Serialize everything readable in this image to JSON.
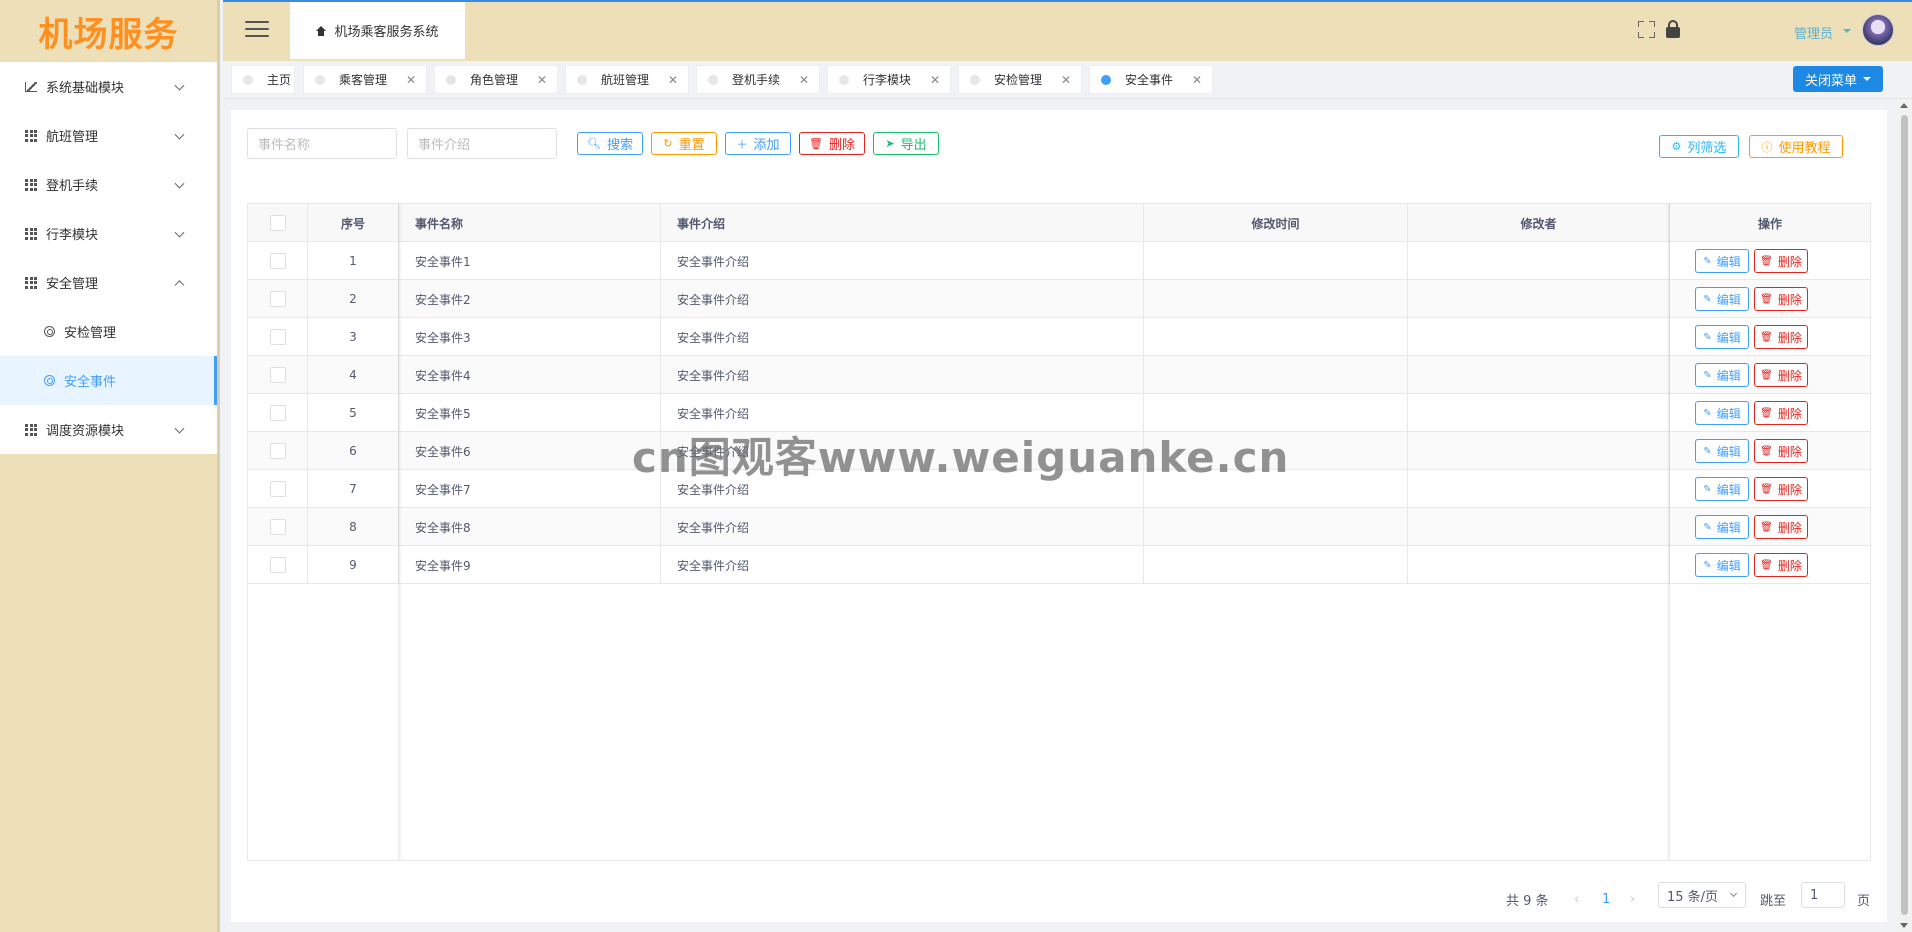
{
  "logo": "机场服务",
  "sidebar": {
    "items": [
      {
        "label": "系统基础模块",
        "icon": "chart-icon"
      },
      {
        "label": "航班管理",
        "icon": "grid-icon"
      },
      {
        "label": "登机手续",
        "icon": "grid-icon"
      },
      {
        "label": "行李模块",
        "icon": "grid-icon"
      },
      {
        "label": "安全管理",
        "icon": "grid-icon",
        "expanded": true
      },
      {
        "label": "安检管理",
        "icon": "circle-icon",
        "sub": true
      },
      {
        "label": "安全事件",
        "icon": "circle-icon",
        "sub": true,
        "active": true
      },
      {
        "label": "调度资源模块",
        "icon": "grid-icon"
      }
    ]
  },
  "header": {
    "home_tab": "机场乘客服务系统",
    "user": "管理员"
  },
  "tabs": [
    {
      "label": "主页",
      "closable": false
    },
    {
      "label": "乘客管理",
      "closable": true
    },
    {
      "label": "角色管理",
      "closable": true
    },
    {
      "label": "航班管理",
      "closable": true
    },
    {
      "label": "登机手续",
      "closable": true
    },
    {
      "label": "行李模块",
      "closable": true
    },
    {
      "label": "安检管理",
      "closable": true
    },
    {
      "label": "安全事件",
      "closable": true,
      "active": true
    }
  ],
  "close_menu": "关闭菜单",
  "search": {
    "name_placeholder": "事件名称",
    "intro_placeholder": "事件介绍"
  },
  "toolbar": {
    "search": "搜索",
    "reset": "重置",
    "add": "添加",
    "delete": "删除",
    "export": "导出",
    "column_filter": "列筛选",
    "tutorial": "使用教程"
  },
  "table": {
    "headers": [
      "序号",
      "事件名称",
      "事件介绍",
      "修改时间",
      "修改者",
      "操作"
    ],
    "rows": [
      {
        "no": "1",
        "name": "安全事件1",
        "intro": "安全事件介绍",
        "time": "",
        "editor": ""
      },
      {
        "no": "2",
        "name": "安全事件2",
        "intro": "安全事件介绍",
        "time": "",
        "editor": ""
      },
      {
        "no": "3",
        "name": "安全事件3",
        "intro": "安全事件介绍",
        "time": "",
        "editor": ""
      },
      {
        "no": "4",
        "name": "安全事件4",
        "intro": "安全事件介绍",
        "time": "",
        "editor": ""
      },
      {
        "no": "5",
        "name": "安全事件5",
        "intro": "安全事件介绍",
        "time": "",
        "editor": ""
      },
      {
        "no": "6",
        "name": "安全事件6",
        "intro": "安全事件介绍",
        "time": "",
        "editor": ""
      },
      {
        "no": "7",
        "name": "安全事件7",
        "intro": "安全事件介绍",
        "time": "",
        "editor": ""
      },
      {
        "no": "8",
        "name": "安全事件8",
        "intro": "安全事件介绍",
        "time": "",
        "editor": ""
      },
      {
        "no": "9",
        "name": "安全事件9",
        "intro": "安全事件介绍",
        "time": "",
        "editor": ""
      }
    ],
    "edit_label": "编辑",
    "delete_label": "删除"
  },
  "pagination": {
    "total": "共 9 条",
    "current": "1",
    "page_size": "15 条/页",
    "jump_label": "跳至",
    "jump_value": "1",
    "page_suffix": "页"
  },
  "watermark": "cn图观客www.weiguanke.cn",
  "colors": {
    "accent": "#409eff",
    "sidebar_bg": "#ede0b8",
    "logo": "#ff8f1f"
  }
}
